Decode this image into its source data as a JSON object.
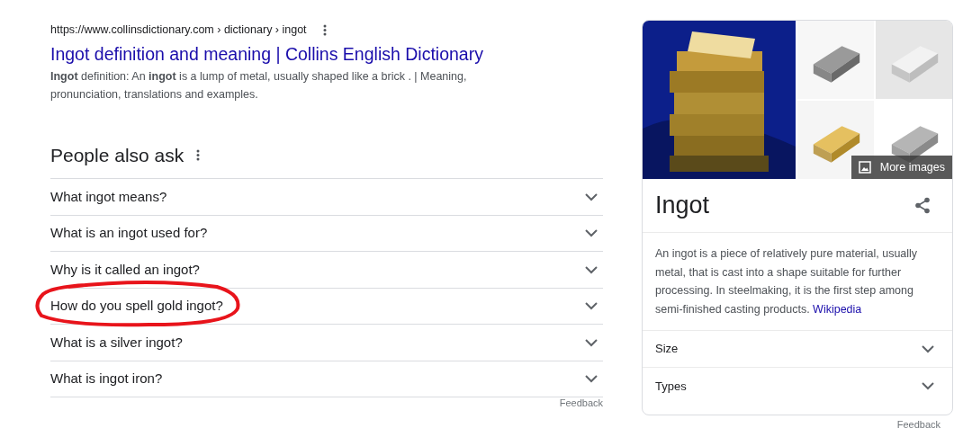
{
  "result": {
    "url": "https://www.collinsdictionary.com › dictionary › ingot",
    "title": "Ingot definition and meaning | Collins English Dictionary",
    "snippet": "**Ingot** definition: An **ingot** is a lump of metal, usually shaped like a brick . | Meaning, pronunciation, translations and examples."
  },
  "people_also_ask": {
    "title": "People also ask",
    "questions": [
      {
        "text": "What ingot means?",
        "expanded": false,
        "circled": false
      },
      {
        "text": "What is an ingot used for?",
        "expanded": false,
        "circled": false
      },
      {
        "text": "Why is it called an ingot?",
        "expanded": false,
        "circled": false
      },
      {
        "text": "How do you spell gold ingot?",
        "expanded": false,
        "circled": true
      },
      {
        "text": "What is a silver ingot?",
        "expanded": false,
        "circled": false
      },
      {
        "text": "What is ingot iron?",
        "expanded": false,
        "circled": false
      }
    ],
    "feedback": "Feedback"
  },
  "knowledge_panel": {
    "more_images": "More images",
    "title": "Ingot",
    "description": "An ingot is a piece of relatively pure material, usually metal, that is cast into a shape suitable for further processing. In steelmaking, it is the first step among semi-finished casting products.",
    "source": "Wikipedia",
    "sections": [
      {
        "label": "Size",
        "expanded": false
      },
      {
        "label": "Types",
        "expanded": false
      }
    ],
    "feedback": "Feedback"
  }
}
